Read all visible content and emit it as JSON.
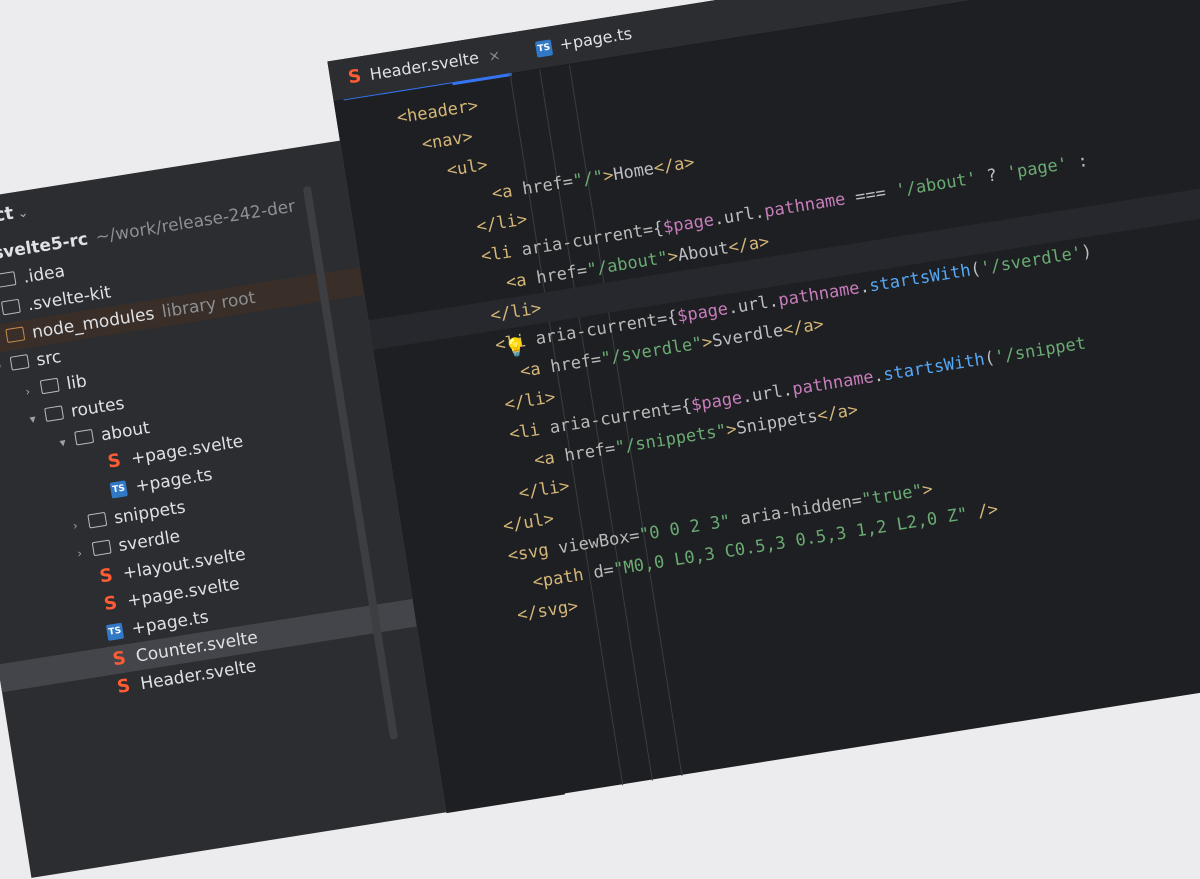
{
  "project": {
    "title": "Project",
    "tree": [
      {
        "indent": 0,
        "arrow": "▾",
        "type": "folder",
        "label": "svelte5-rc",
        "extra": "~/work/release-242-der",
        "bold": true
      },
      {
        "indent": 1,
        "arrow": "›",
        "type": "folder",
        "label": ".idea"
      },
      {
        "indent": 1,
        "arrow": "›",
        "type": "folder",
        "label": ".svelte-kit"
      },
      {
        "indent": 1,
        "arrow": "›",
        "type": "folder-orange",
        "label": "node_modules",
        "extra": "library root",
        "hl": true
      },
      {
        "indent": 1,
        "arrow": "▾",
        "type": "folder",
        "label": "src"
      },
      {
        "indent": 2,
        "arrow": "›",
        "type": "folder",
        "label": "lib"
      },
      {
        "indent": 2,
        "arrow": "▾",
        "type": "folder",
        "label": "routes"
      },
      {
        "indent": 3,
        "arrow": "▾",
        "type": "folder",
        "label": "about"
      },
      {
        "indent": 4,
        "arrow": "",
        "type": "svelte",
        "label": "+page.svelte"
      },
      {
        "indent": 4,
        "arrow": "",
        "type": "ts",
        "label": "+page.ts"
      },
      {
        "indent": 3,
        "arrow": "›",
        "type": "folder",
        "label": "snippets"
      },
      {
        "indent": 3,
        "arrow": "›",
        "type": "folder",
        "label": "sverdle"
      },
      {
        "indent": 3,
        "arrow": "",
        "type": "svelte",
        "label": "+layout.svelte"
      },
      {
        "indent": 3,
        "arrow": "",
        "type": "svelte",
        "label": "+page.svelte"
      },
      {
        "indent": 3,
        "arrow": "",
        "type": "ts",
        "label": "+page.ts"
      },
      {
        "indent": 3,
        "arrow": "",
        "type": "svelte",
        "label": "Counter.svelte",
        "sel": true
      },
      {
        "indent": 3,
        "arrow": "",
        "type": "svelte",
        "label": "Header.svelte"
      }
    ]
  },
  "tabs": [
    {
      "label": "Header.svelte",
      "icon": "svelte",
      "active": true,
      "close": "×"
    },
    {
      "label": "+page.ts",
      "icon": "ts",
      "active": false
    }
  ],
  "ts_badge": "TS",
  "svelte_glyph": "S",
  "bulb_glyph": "💡",
  "code": [
    [
      [
        "tag",
        "<header>"
      ]
    ],
    [
      [
        "tag",
        "  <nav>"
      ]
    ],
    [
      [
        "tag",
        "    <ul>"
      ]
    ],
    [
      [
        "tag",
        "        <a "
      ],
      [
        "attr",
        "href="
      ],
      [
        "str",
        "\"/\""
      ],
      [
        "tag",
        ">"
      ],
      [
        "punc",
        "Home"
      ],
      [
        "tag",
        "</a>"
      ]
    ],
    [
      [
        "tag",
        "      </li>"
      ]
    ],
    [
      [
        "tag",
        "      <li "
      ],
      [
        "attr",
        "aria-current="
      ],
      [
        "punc",
        "{"
      ],
      [
        "var",
        "$page"
      ],
      [
        "punc",
        ".url."
      ],
      [
        "var",
        "pathname"
      ],
      [
        "punc",
        " === "
      ],
      [
        "str",
        "'/about'"
      ],
      [
        "punc",
        " ? "
      ],
      [
        "str",
        "'page'"
      ],
      [
        "punc",
        " :"
      ]
    ],
    [
      [
        "tag",
        "        <a "
      ],
      [
        "attr",
        "href="
      ],
      [
        "str",
        "\"/about\""
      ],
      [
        "tag",
        ">"
      ],
      [
        "punc",
        "About"
      ],
      [
        "tag",
        "</a>"
      ]
    ],
    [
      [
        "tag",
        "      </li>"
      ]
    ],
    [
      [
        "tag",
        "      <li "
      ],
      [
        "attr",
        "aria-current="
      ],
      [
        "punc",
        "{"
      ],
      [
        "var",
        "$page"
      ],
      [
        "punc",
        ".url."
      ],
      [
        "var",
        "pathname"
      ],
      [
        "punc",
        "."
      ],
      [
        "method",
        "startsWith"
      ],
      [
        "punc",
        "("
      ],
      [
        "str",
        "'/sverdle'"
      ],
      [
        "punc",
        ")"
      ]
    ],
    [
      [
        "tag",
        "        <a "
      ],
      [
        "attr",
        "href="
      ],
      [
        "str",
        "\"/sverdle\""
      ],
      [
        "tag",
        ">"
      ],
      [
        "punc",
        "Sverdle"
      ],
      [
        "tag",
        "</a>"
      ]
    ],
    [
      [
        "tag",
        "      </li>"
      ]
    ],
    [
      [
        "tag",
        "      <li "
      ],
      [
        "attr",
        "aria-current="
      ],
      [
        "punc",
        "{"
      ],
      [
        "var",
        "$page"
      ],
      [
        "punc",
        ".url."
      ],
      [
        "var",
        "pathname"
      ],
      [
        "punc",
        "."
      ],
      [
        "method",
        "startsWith"
      ],
      [
        "punc",
        "("
      ],
      [
        "str",
        "'/snippet"
      ]
    ],
    [
      [
        "tag",
        "        <a "
      ],
      [
        "attr",
        "href="
      ],
      [
        "str",
        "\"/snippets\""
      ],
      [
        "tag",
        ">"
      ],
      [
        "punc",
        "Snippets"
      ],
      [
        "tag",
        "</a>"
      ]
    ],
    [
      [
        "tag",
        "      </li>"
      ]
    ],
    [
      [
        "tag",
        "    </ul>"
      ]
    ],
    [
      [
        "tag",
        "    <svg "
      ],
      [
        "attr",
        "viewBox="
      ],
      [
        "str",
        "\"0 0 2 3\""
      ],
      [
        "attr",
        " aria-hidden="
      ],
      [
        "str",
        "\"true\""
      ],
      [
        "tag",
        ">"
      ]
    ],
    [
      [
        "tag",
        "      <path "
      ],
      [
        "attr",
        "d="
      ],
      [
        "str",
        "\"M0,0 L0,3 C0.5,3 0.5,3 1,2 L2,0 Z\""
      ],
      [
        "tag",
        " />"
      ]
    ],
    [
      [
        "tag",
        "    </svg>"
      ]
    ]
  ]
}
